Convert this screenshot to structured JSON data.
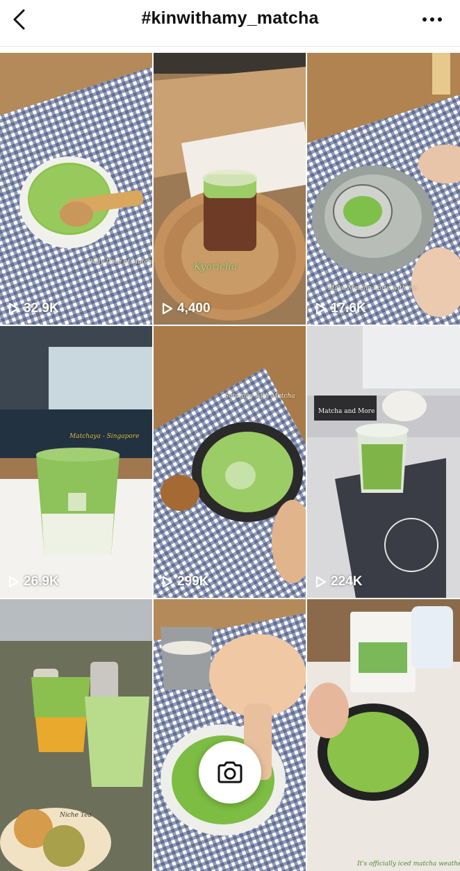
{
  "header": {
    "title": "#kinwithamy_matcha",
    "back_icon": "chevron-left-icon",
    "more_icon": "more-horizontal-icon"
  },
  "grid": {
    "tiles": [
      {
        "views": "32.9K",
        "caption": "Daily Dose of Matcha"
      },
      {
        "views": "4,400",
        "caption": "Kyoricha"
      },
      {
        "views": "17.6K",
        "caption": "Make Matcha Latte with me"
      },
      {
        "views": "26.9K",
        "caption": "Matchaya - Singapore"
      },
      {
        "views": "299K",
        "caption": "Saturday with Matcha"
      },
      {
        "views": "224K",
        "caption": "Matcha and More"
      },
      {
        "views": "",
        "caption": "Niche Tea"
      },
      {
        "views": "",
        "caption": ""
      },
      {
        "views": "",
        "caption": "It's officially iced matcha weather"
      }
    ]
  },
  "camera_button": {
    "icon": "camera-icon"
  },
  "colors": {
    "matcha": "#7fb548",
    "gingham": "#2f3f6e",
    "wood": "#b98a5a"
  }
}
